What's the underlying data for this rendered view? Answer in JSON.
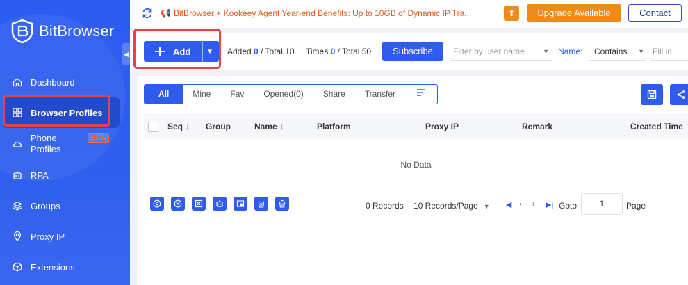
{
  "app": {
    "name": "BitBrowser"
  },
  "sidebar": {
    "items": [
      {
        "label": "Dashboard",
        "icon": "home-icon"
      },
      {
        "label": "Browser Profiles",
        "icon": "grid-icon",
        "active": true
      },
      {
        "label_line1": "Phone",
        "label_line2": "Profiles",
        "icon": "cloud-phone-icon",
        "badge": "NEW"
      },
      {
        "label": "RPA",
        "icon": "robot-icon"
      },
      {
        "label": "Groups",
        "icon": "layers-icon"
      },
      {
        "label": "Proxy IP",
        "icon": "location-pin-icon"
      },
      {
        "label": "Extensions",
        "icon": "cube-icon"
      }
    ]
  },
  "topbar": {
    "announcement": "BitBrowser + Kookeey Agent Year-end Benefits: Up to 10GB of Dynamic IP Tra...",
    "upgrade_label": "Upgrade Available",
    "contact_label": "Contact"
  },
  "toolbar": {
    "add_label": "Add",
    "added_prefix": "Added",
    "added_count": "0",
    "added_total": "/ Total 10",
    "times_prefix": "Times",
    "times_count": "0",
    "times_total": "/ Total 50",
    "subscribe_label": "Subscribe",
    "filter_user_placeholder": "Filter by user name",
    "name_label": "Name:",
    "match_mode": "Contains",
    "fill_in_placeholder": "Fill in"
  },
  "tabs": [
    "All",
    "Mine",
    "Fav",
    "Opened(0)",
    "Share",
    "Transfer"
  ],
  "table": {
    "columns": [
      "Seq",
      "Group",
      "Name",
      "Platform",
      "Proxy IP",
      "Remark",
      "Created Time"
    ],
    "empty_text": "No Data"
  },
  "pager": {
    "records": "0 Records",
    "page_size": "10 Records/Page",
    "goto_label": "Goto",
    "page_value": "1",
    "page_label": "Page"
  },
  "colors": {
    "primary": "#2f5ceb",
    "accent_orange": "#f08a1c",
    "highlight_red": "#e0454e"
  }
}
